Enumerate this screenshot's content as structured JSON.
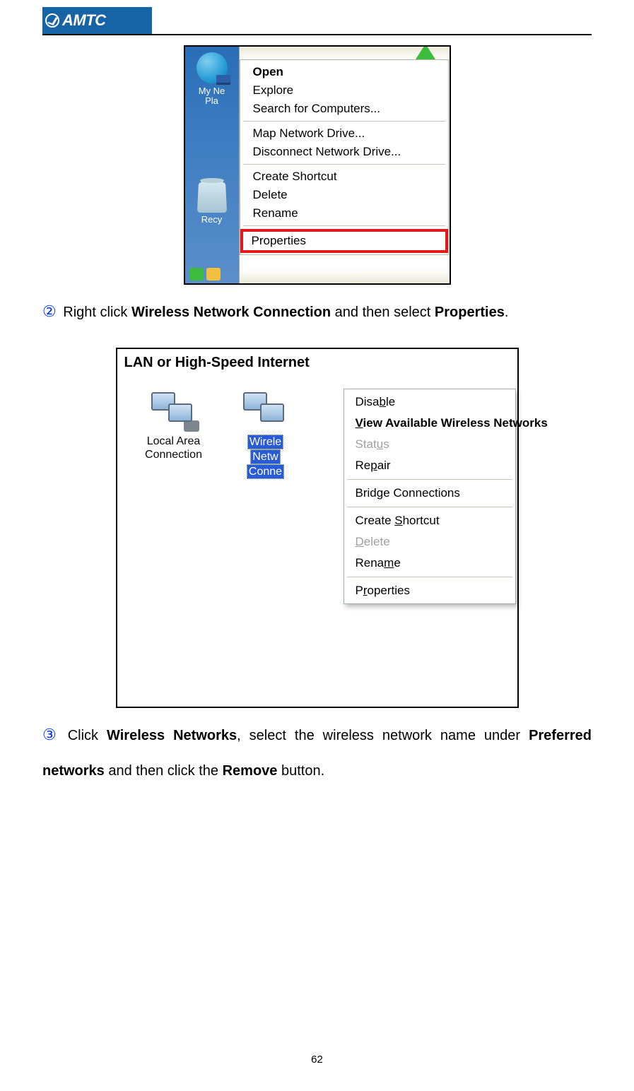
{
  "logo": {
    "text": "AMTC"
  },
  "fig1": {
    "icons": {
      "myNetwork": "My Ne\nPla",
      "recycle": "Recy"
    },
    "menu": {
      "open": "Open",
      "explore": "Explore",
      "search": "Search for Computers...",
      "map": "Map Network Drive...",
      "disconnect": "Disconnect Network Drive...",
      "shortcut": "Create Shortcut",
      "delete": "Delete",
      "rename": "Rename",
      "properties": "Properties"
    }
  },
  "step2": {
    "num": "②",
    "t1": "Right click ",
    "b1": "Wireless Network Connection",
    "t2": " and then select ",
    "b2": "Properties",
    "t3": "."
  },
  "fig2": {
    "title": "LAN or High-Speed Internet",
    "local": "Local Area\nConnection",
    "wireless": [
      "Wirele",
      "Netw",
      "Conne"
    ],
    "menu": {
      "disable": {
        "pre": "Disa",
        "u": "b",
        "post": "le"
      },
      "view": {
        "pre": "",
        "u": "V",
        "post": "iew Available Wireless Networks"
      },
      "status": {
        "pre": "Stat",
        "u": "u",
        "post": "s"
      },
      "repair": {
        "pre": "Re",
        "u": "p",
        "post": "air"
      },
      "bridge": {
        "pre": "Brid",
        "u": "g",
        "post": "e Connections"
      },
      "shortcut": {
        "pre": "Create ",
        "u": "S",
        "post": "hortcut"
      },
      "delete": {
        "pre": "",
        "u": "D",
        "post": "elete"
      },
      "rename": {
        "pre": "Rena",
        "u": "m",
        "post": "e"
      },
      "props": {
        "pre": "P",
        "u": "r",
        "post": "operties"
      }
    }
  },
  "step3": {
    "num": "③",
    "t1": "  Click  ",
    "b1": "Wireless  Networks",
    "t2": ",  select  the  wireless  network  name  under  ",
    "b2": "Preferred networks",
    "t3": " and then click the ",
    "b3": "Remove",
    "t4": " button."
  },
  "page_number": "62"
}
